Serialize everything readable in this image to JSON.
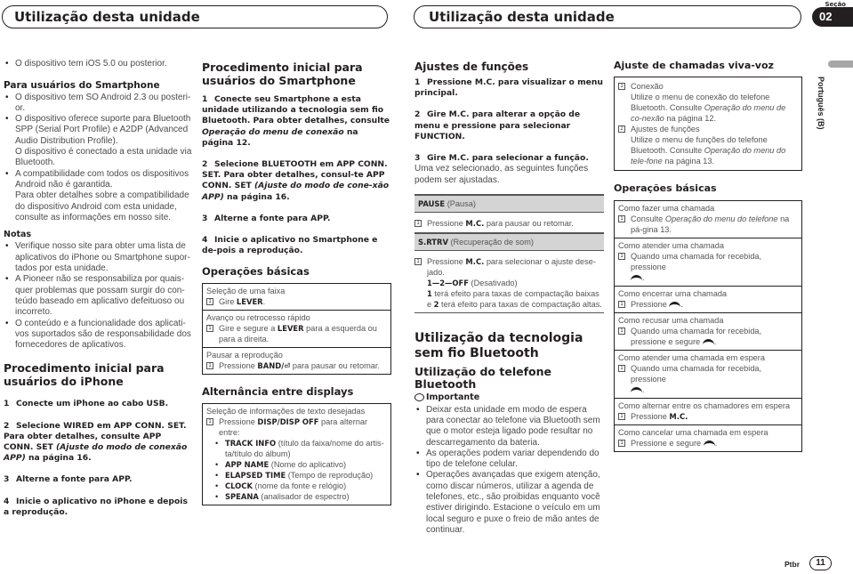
{
  "header": {
    "left_title": "Utilização desta unidade",
    "right_title": "Utilização desta unidade",
    "section_label": "Seção",
    "section_number": "02"
  },
  "col1": {
    "ios_bullet": "O dispositivo tem iOS 5.0 ou posterior.",
    "smartphone_heading": "Para usuários do Smartphone",
    "smartphone_bullets": [
      "O dispositivo tem SO Android 2.3 ou posteri-or.",
      "O dispositivo oferece suporte para Bluetooth SPP (Serial Port Profile) e A2DP (Advanced Audio Distribution Profile).",
      "A compatibilidade com todos os dispositivos Android não é garantida."
    ],
    "smartphone_bullet2_extra": "O dispositivo é conectado a esta unidade via Bluetooth.",
    "smartphone_bullet3_extra": "Para obter detalhes sobre a compatibilidade do dispositivo Android com esta unidade, consulte as informações em nosso site.",
    "notes_heading": "Notas",
    "notes": [
      "Verifique nosso site para obter uma lista de aplicativos do iPhone ou Smartphone supor-tados por esta unidade.",
      "A Pioneer não se responsabiliza por quais-quer problemas que possam surgir do con-teúdo baseado em aplicativo defeituoso ou incorreto.",
      "O conteúdo e a funcionalidade dos aplicati-vos suportados são de responsabilidade dos fornecedores de aplicativos."
    ],
    "iphone_heading": "Procedimento inicial para usuários do iPhone",
    "iphone_steps": [
      {
        "num": "1",
        "text": "Conecte um iPhone ao cabo USB."
      },
      {
        "num": "2",
        "text": "Selecione WIRED em APP CONN. SET.",
        "extra": "Para obter detalhes, consulte APP CONN. SET ",
        "extra_italic": "(Ajuste do modo de conexão APP)",
        "extra_end": " na página 16."
      },
      {
        "num": "3",
        "text": "Alterne a fonte para APP."
      },
      {
        "num": "4",
        "text": "Inicie o aplicativo no iPhone e depois a reprodução."
      }
    ]
  },
  "col2": {
    "smartphone_heading": "Procedimento inicial para usuários do Smartphone",
    "steps": [
      {
        "num": "1",
        "text": "Conecte seu Smartphone a esta unidade utilizando a tecnologia sem fio Bluetooth. Para obter detalhes, consulte ",
        "italic": "Operação do menu de conexão",
        "end": " na página 12."
      },
      {
        "num": "2",
        "text": "Selecione BLUETOOTH em APP CONN. SET. Para obter detalhes, consul-te APP CONN. SET ",
        "italic": "(Ajuste do modo de cone-xão APP)",
        "end": " na página 16."
      },
      {
        "num": "3",
        "text": "Alterne a fonte para APP."
      },
      {
        "num": "4",
        "text": "Inicie o aplicativo no Smartphone e de-pois a reprodução."
      }
    ],
    "basic_ops_heading": "Operações básicas",
    "basic_ops": [
      {
        "title": "Seleção de uma faixa",
        "step_pre": "Gire ",
        "step_bold": "LEVER",
        "step_post": "."
      },
      {
        "title": "Avanço ou retrocesso rápido",
        "step_pre": "Gire e segure a ",
        "step_bold": "LEVER",
        "step_post": " para a esquerda ou para a direita."
      },
      {
        "title": "Pausar a reprodução",
        "step_pre": "Pressione ",
        "step_bold": "BAND/⏎",
        "step_post": " para pausar ou retomar."
      }
    ],
    "displays_heading": "Alternância entre displays",
    "displays_title": "Seleção de informações de texto desejadas",
    "displays_step_pre": "Pressione ",
    "displays_step_bold": "DISP/DISP OFF",
    "displays_step_post": " para alternar entre:",
    "displays_items": [
      {
        "bold": "TRACK INFO",
        "text": " (título da faixa/nome do artis-ta/título do álbum)"
      },
      {
        "bold": "APP NAME",
        "text": " (Nome do aplicativo)"
      },
      {
        "bold": "ELAPSED TIME",
        "text": " (Tempo de reprodução)"
      },
      {
        "bold": "CLOCK",
        "text": " (nome da fonte e relógio)"
      },
      {
        "bold": "SPEANA",
        "text": " (analisador de espectro)"
      }
    ],
    "step_marker": "1"
  },
  "col3": {
    "functions_heading": "Ajustes de funções",
    "steps": [
      {
        "num": "1",
        "text": "Pressione M.C. para visualizar o menu principal."
      },
      {
        "num": "2",
        "text": "Gire M.C. para alterar a opção de menu e pressione para selecionar FUNCTION."
      },
      {
        "num": "3",
        "text": "Gire M.C. para selecionar a função."
      }
    ],
    "step3_extra": "Uma vez selecionado, as seguintes funções podem ser ajustadas.",
    "pause_bold": "PAUSE",
    "pause_text": " (Pausa)",
    "pause_step_pre": "Pressione ",
    "pause_step_bold": "M.C.",
    "pause_step_post": " para pausar ou retomar.",
    "srtrv_bold": "S.RTRV",
    "srtrv_text": " (Recuperação de som)",
    "srtrv_step_pre": "Pressione ",
    "srtrv_step_bold": "M.C.",
    "srtrv_step_post": " para selecionar o ajuste dese-jado.",
    "srtrv_options_bold": "1—2—OFF",
    "srtrv_options_text": " (Desativado)",
    "srtrv_l1_bold": "1",
    "srtrv_l1": " terá efeito para taxas de compactação baixas e ",
    "srtrv_l2_bold": "2",
    "srtrv_l2": " terá efeito para taxas de compactação altas.",
    "bt_heading": "Utilização da tecnologia sem fio Bluetooth",
    "bt_phone_heading": "Utilização do telefone Bluetooth",
    "important_label": "Importante",
    "important_bullets": [
      "Deixar esta unidade em modo de espera para conectar ao telefone via Bluetooth sem que o motor esteja ligado pode resultar no descarregamento da bateria.",
      "As operações podem variar dependendo do tipo de telefone celular.",
      "Operações avançadas que exigem atenção, como discar números, utilizar a agenda de telefones, etc., são proibidas enquanto você estiver dirigindo. Estacione o veículo em um local seguro e puxe o freio de mão antes de continuar."
    ]
  },
  "col4": {
    "handsfree_heading": "Ajuste de chamadas viva-voz",
    "handsfree_items": [
      {
        "num": "1",
        "title": "Conexão",
        "text": "Utilize o menu de conexão do telefone Bluetooth. Consulte ",
        "italic": "Operação do menu de co-nexão",
        "end": " na página 12."
      },
      {
        "num": "2",
        "title": "Ajustes de funções",
        "text": "Utilize o menu de funções do telefone Bluetooth. Consulte ",
        "italic": "Operação do menu do tele-fone",
        "end": " na página 13."
      }
    ],
    "basic_ops_heading": "Operações básicas",
    "ops": [
      {
        "title": "Como fazer uma chamada",
        "pre": "Consulte ",
        "italic": "Operação do menu do telefone",
        "post": " na pá-gina 13."
      },
      {
        "title": "Como atender uma chamada",
        "pre": "Quando uma chamada for recebida, pressione",
        "phone": true,
        "post": "."
      },
      {
        "title": "Como encerrar uma chamada",
        "pre": "Pressione ",
        "phone": true,
        "post": "."
      },
      {
        "title": "Como recusar uma chamada",
        "pre": "Quando uma chamada for recebida, pressione e segure ",
        "phone": true,
        "post": "."
      },
      {
        "title": "Como atender uma chamada em espera",
        "pre": "Quando uma chamada for recebida, pressione",
        "phone": true,
        "post": "."
      },
      {
        "title": "Como alternar entre os chamadores em espera",
        "pre": "Pressione ",
        "bold": "M.C.",
        "post": ""
      },
      {
        "title": "Como cancelar uma chamada em espera",
        "pre": "Pressione e segure ",
        "phone": true,
        "post": "."
      }
    ]
  },
  "side": {
    "language": "Português (B)"
  },
  "footer": {
    "language_code": "Ptbr",
    "page_number": "11"
  }
}
